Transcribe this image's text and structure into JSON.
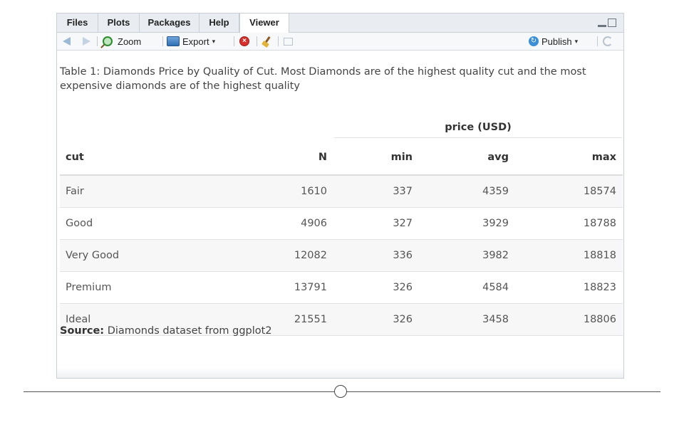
{
  "tabs": [
    {
      "label": "Files"
    },
    {
      "label": "Plots"
    },
    {
      "label": "Packages"
    },
    {
      "label": "Help"
    },
    {
      "label": "Viewer",
      "active": true
    }
  ],
  "toolbar": {
    "zoom_label": "Zoom",
    "export_label": "Export",
    "export_caret": "▾",
    "publish_label": "Publish",
    "publish_caret": "▾"
  },
  "icons": {
    "back": "back-arrow-icon",
    "forward": "forward-arrow-icon",
    "zoom": "zoom-magnifier-icon",
    "export": "export-image-icon",
    "clear": "clear-viewer-icon",
    "broom": "broom-icon",
    "popout": "popout-window-icon",
    "publish": "publish-icon",
    "refresh": "refresh-icon",
    "minimize": "minimize-icon",
    "maximize": "maximize-icon"
  },
  "table": {
    "caption": "Table 1: Diamonds Price by Quality of Cut. Most Diamonds are of the highest quality cut and the most expensive diamonds are of the highest quality",
    "spanner": "price (USD)",
    "columns": [
      "cut",
      "N",
      "min",
      "avg",
      "max"
    ],
    "rows": [
      {
        "cut": "Fair",
        "n": "1610",
        "min": "337",
        "avg": "4359",
        "max": "18574"
      },
      {
        "cut": "Good",
        "n": "4906",
        "min": "327",
        "avg": "3929",
        "max": "18788"
      },
      {
        "cut": "Very Good",
        "n": "12082",
        "min": "336",
        "avg": "3982",
        "max": "18818"
      },
      {
        "cut": "Premium",
        "n": "13791",
        "min": "326",
        "avg": "4584",
        "max": "18823"
      },
      {
        "cut": "Ideal",
        "n": "21551",
        "min": "326",
        "avg": "3458",
        "max": "18806"
      }
    ],
    "source_label": "Source:",
    "source_text": "Diamonds dataset from ggplot2"
  },
  "colors": {
    "tabbar_bg": "#e9edf2",
    "stripe": "#f7f7f7",
    "publish_accent": "#3a8fd6",
    "clear_red": "#d9302b"
  }
}
